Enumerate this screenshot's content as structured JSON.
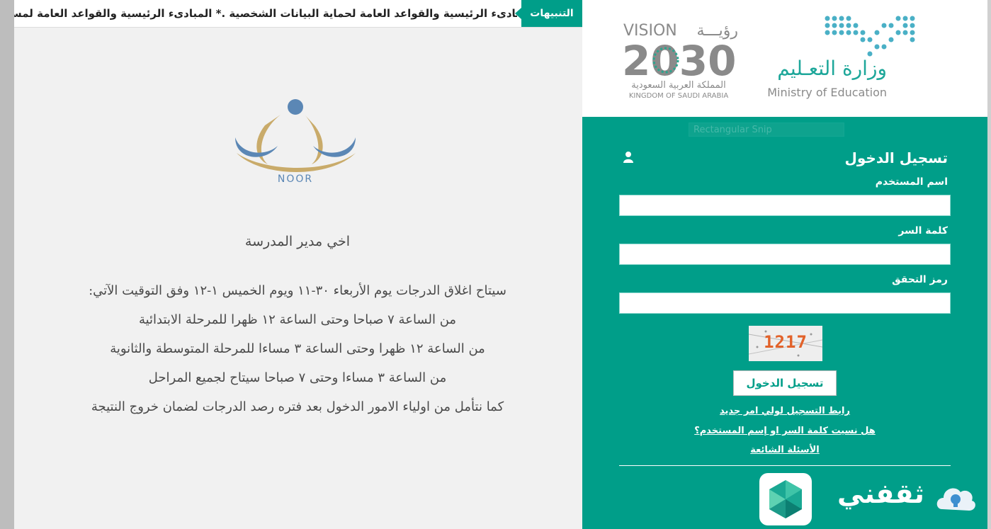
{
  "ticker": {
    "label": "التنبيهات",
    "text": "المبادىء الرئيسية والقواعد العامة لحماية البيانات الشخصية .* المبادىء الرئيسية والقواعد العامة لمس"
  },
  "logos": {
    "vision_en": "VISION",
    "vision_ar": "رؤيـــة",
    "vision_year": "2030",
    "kingdom_ar": "المملكة العربية السعودية",
    "kingdom_en": "KINGDOM OF SAUDI ARABIA",
    "ministry_ar": "وزارة التعـليم",
    "ministry_en": "Ministry of Education",
    "noor": "NOOR"
  },
  "message": {
    "title": "اخي مدير المدرسة",
    "lines": [
      "سيتاح اغلاق الدرجات يوم الأربعاء ٣٠-١١ ويوم الخميس ١-١٢ وفق التوقيت الآتي:",
      "من الساعة ٧ صباحا وحتى الساعة ١٢ ظهرا للمرحلة الابتدائية",
      "من الساعة ١٢ ظهرا وحتى الساعة ٣ مساءا للمرحلة المتوسطة والثانوية",
      "من الساعة ٣ مساءا وحتى ٧ صباحا سيتاح لجميع المراحل",
      "كما نتأمل من اولياء الامور الدخول بعد فتره رصد الدرجات لضمان خروج النتيجة"
    ]
  },
  "login": {
    "ghost": "Rectangular Snip",
    "title": "تسجيل الدخول",
    "username_label": "اسم المستخدم",
    "password_label": "كلمة السر",
    "captcha_label": "رمز التحقق",
    "captcha_code": "1217",
    "submit": "تسجيل الدخول",
    "links": [
      "رابط التسجيل لولي امر جديد",
      "هل نسيت كلمة السر او إسم المستخدم؟",
      "الأسئلة الشائعة"
    ]
  },
  "brand": {
    "name": "ثقفني"
  },
  "colors": {
    "accent": "#009e89",
    "logo_blue": "#5b87b5",
    "logo_gold": "#c9ab6a",
    "ministry_teal": "#1ea79a",
    "ministry_blue": "#4ab0c6"
  }
}
